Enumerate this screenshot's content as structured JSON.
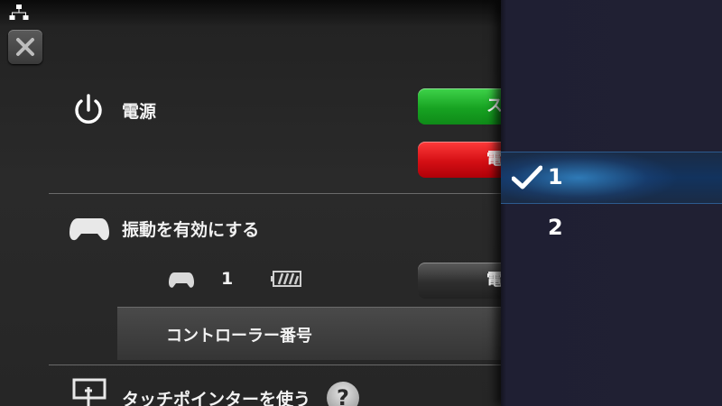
{
  "settings": {
    "power": {
      "label": "電源",
      "button_green": "ス",
      "button_red": "電"
    },
    "vibration": {
      "label": "振動を有効にする"
    },
    "controller": {
      "number": "1",
      "button_gray": "電",
      "number_row_label": "コントローラー番号"
    },
    "touch_pointer": {
      "label": "タッチポインターを使う",
      "help": "?"
    }
  },
  "picker": {
    "options": [
      {
        "label": "1",
        "selected": true
      },
      {
        "label": "2",
        "selected": false
      }
    ]
  },
  "colors": {
    "accent_blue": "#2c8fe0",
    "power_green": "#17a322",
    "power_red": "#d40f14"
  }
}
